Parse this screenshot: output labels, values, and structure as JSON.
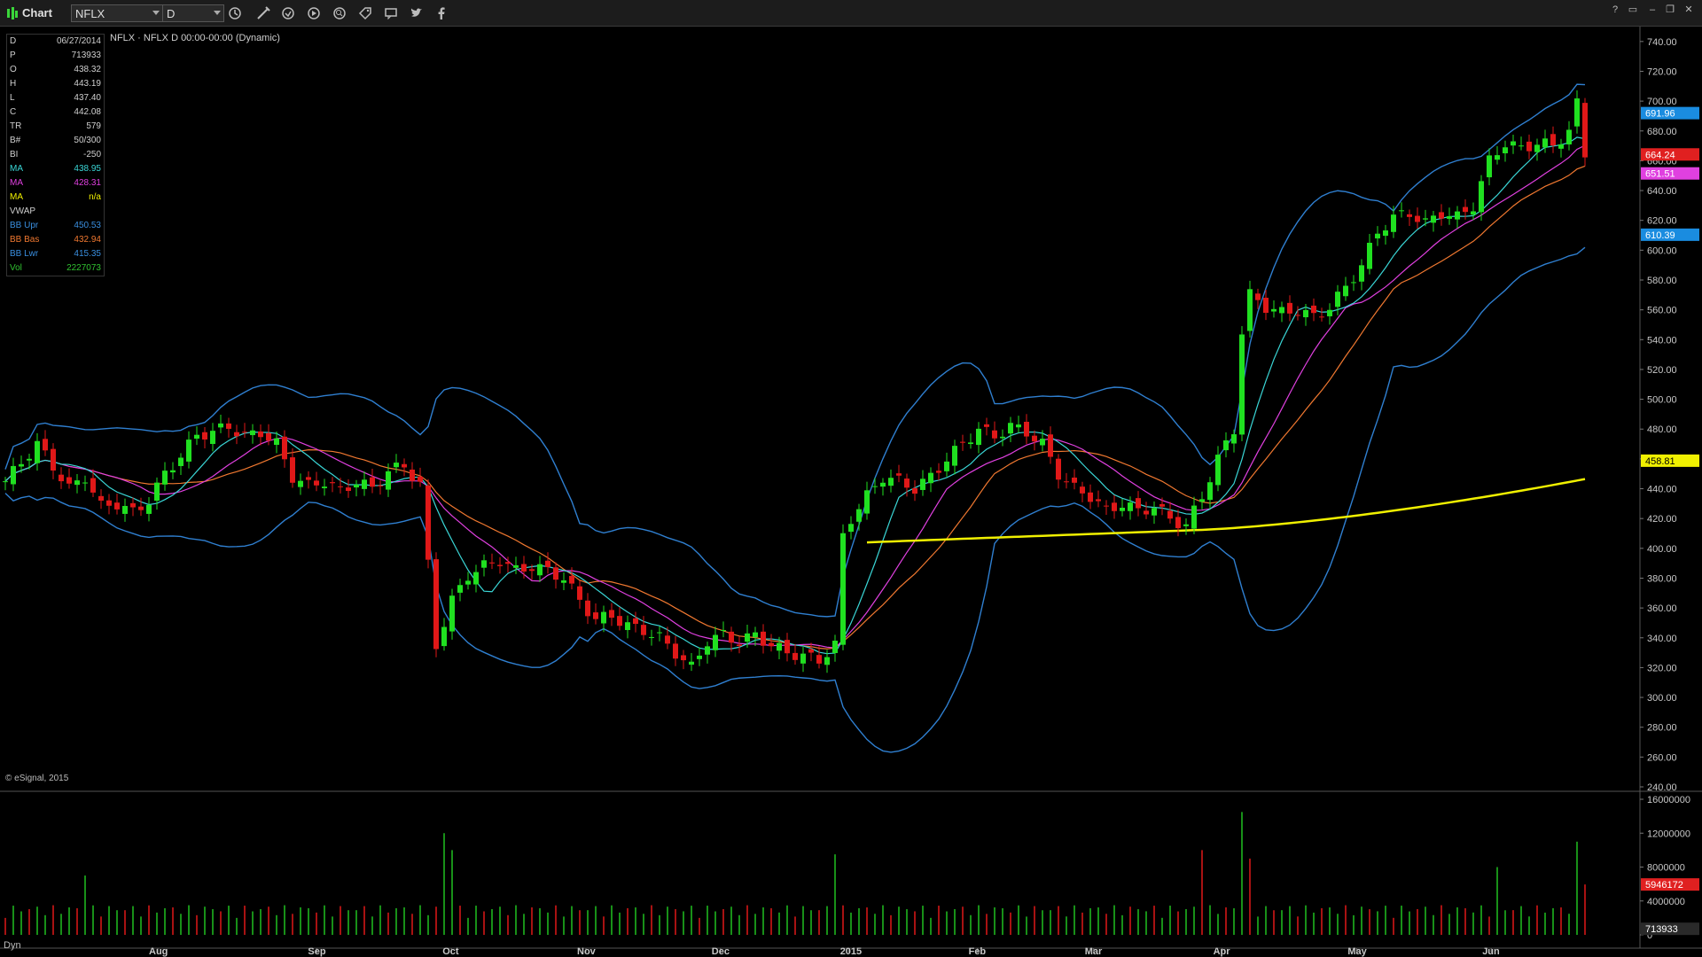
{
  "window": {
    "title": "Chart"
  },
  "toolbar": {
    "symbol": "NFLX",
    "interval": "D",
    "icons": [
      "interval-settings-icon",
      "draw-line-icon",
      "refresh-icon",
      "play-icon",
      "search-icon",
      "tag-icon",
      "message-icon",
      "twitter-icon",
      "facebook-icon"
    ]
  },
  "window_controls": [
    "?",
    "▭",
    "–",
    "❐",
    "✕"
  ],
  "header_label": "NFLX · NFLX D  00:00-00:00 (Dynamic)",
  "info_panel": [
    {
      "label": "D",
      "value": "06/27/2014",
      "color": "#cfcfcf"
    },
    {
      "label": "P",
      "value": "713933",
      "color": "#cfcfcf"
    },
    {
      "label": "O",
      "value": "438.32",
      "color": "#cfcfcf"
    },
    {
      "label": "H",
      "value": "443.19",
      "color": "#cfcfcf"
    },
    {
      "label": "L",
      "value": "437.40",
      "color": "#cfcfcf"
    },
    {
      "label": "C",
      "value": "442.08",
      "color": "#cfcfcf"
    },
    {
      "label": "TR",
      "value": "579",
      "color": "#cfcfcf"
    },
    {
      "label": "B#",
      "value": "50/300",
      "color": "#cfcfcf"
    },
    {
      "label": "BI",
      "value": "-250",
      "color": "#cfcfcf"
    },
    {
      "label": "MA",
      "value": "438.95",
      "color": "#3ad6d6"
    },
    {
      "label": "MA",
      "value": "428.31",
      "color": "#e040e0"
    },
    {
      "label": "MA",
      "value": "n/a",
      "color": "#f0f000"
    },
    {
      "label": "VWAP",
      "value": "",
      "color": "#cfcfcf"
    },
    {
      "label": "BB Upr",
      "value": "450.53",
      "color": "#3a8fe0"
    },
    {
      "label": "BB Bas",
      "value": "432.94",
      "color": "#f07830"
    },
    {
      "label": "BB Lwr",
      "value": "415.35",
      "color": "#3a8fe0"
    },
    {
      "label": "Vol",
      "value": "2227073",
      "color": "#30c030"
    }
  ],
  "copyright": "© eSignal, 2015",
  "dyn_label": "Dyn",
  "chart_data": {
    "type": "candlestick",
    "title": "",
    "price_axis": {
      "ylim": [
        240,
        750
      ],
      "ticks": [
        240,
        260,
        280,
        300,
        320,
        340,
        360,
        380,
        400,
        420,
        440,
        460,
        480,
        500,
        520,
        540,
        560,
        580,
        600,
        620,
        640,
        660,
        680,
        700,
        720,
        740
      ]
    },
    "volume_axis": {
      "ylim": [
        0,
        16000000
      ],
      "ticks": [
        0,
        4000000,
        8000000,
        12000000,
        16000000
      ]
    },
    "x_ticks": [
      "Aug",
      "Sep",
      "Oct",
      "Nov",
      "Dec",
      "2015",
      "Feb",
      "Mar",
      "Apr",
      "May",
      "Jun"
    ],
    "price_tags": [
      {
        "value": "691.96",
        "bg": "#1a8ce0",
        "fg": "#ffffff"
      },
      {
        "value": "664.24",
        "bg": "#e02020",
        "fg": "#ffffff"
      },
      {
        "value": "651.51",
        "bg": "#e040e0",
        "fg": "#ffffff"
      },
      {
        "value": "610.39",
        "bg": "#1a8ce0",
        "fg": "#ffffff"
      },
      {
        "value": "458.81",
        "bg": "#f0f000",
        "fg": "#000000"
      }
    ],
    "volume_tags": [
      {
        "value": "5946172",
        "bg": "#e02020",
        "fg": "#ffffff"
      },
      {
        "value": "713933",
        "bg": "#2a2a2a",
        "fg": "#ffffff"
      }
    ],
    "close_path": [
      [
        0,
        445
      ],
      [
        4,
        470
      ],
      [
        6,
        455
      ],
      [
        8,
        440
      ],
      [
        10,
        448
      ],
      [
        12,
        428
      ],
      [
        14,
        430
      ],
      [
        16,
        424
      ],
      [
        18,
        432
      ],
      [
        20,
        450
      ],
      [
        22,
        462
      ],
      [
        24,
        476
      ],
      [
        26,
        478
      ],
      [
        28,
        482
      ],
      [
        30,
        475
      ],
      [
        32,
        478
      ],
      [
        34,
        470
      ],
      [
        36,
        448
      ],
      [
        38,
        442
      ],
      [
        40,
        445
      ],
      [
        42,
        438
      ],
      [
        44,
        445
      ],
      [
        46,
        440
      ],
      [
        48,
        452
      ],
      [
        50,
        455
      ],
      [
        52,
        443
      ],
      [
        54,
        335
      ],
      [
        56,
        365
      ],
      [
        58,
        382
      ],
      [
        60,
        388
      ],
      [
        62,
        392
      ],
      [
        64,
        385
      ],
      [
        66,
        388
      ],
      [
        68,
        385
      ],
      [
        70,
        380
      ],
      [
        72,
        365
      ],
      [
        74,
        352
      ],
      [
        76,
        355
      ],
      [
        78,
        348
      ],
      [
        80,
        345
      ],
      [
        82,
        340
      ],
      [
        84,
        330
      ],
      [
        86,
        320
      ],
      [
        88,
        338
      ],
      [
        90,
        342
      ],
      [
        92,
        337
      ],
      [
        94,
        342
      ],
      [
        96,
        335
      ],
      [
        98,
        330
      ],
      [
        100,
        328
      ],
      [
        102,
        325
      ],
      [
        104,
        335
      ],
      [
        105,
        408
      ],
      [
        106,
        420
      ],
      [
        108,
        435
      ],
      [
        110,
        448
      ],
      [
        112,
        445
      ],
      [
        114,
        440
      ],
      [
        116,
        448
      ],
      [
        118,
        460
      ],
      [
        120,
        470
      ],
      [
        122,
        480
      ],
      [
        124,
        475
      ],
      [
        126,
        482
      ],
      [
        128,
        478
      ],
      [
        130,
        470
      ],
      [
        132,
        450
      ],
      [
        134,
        440
      ],
      [
        136,
        435
      ],
      [
        138,
        425
      ],
      [
        140,
        430
      ],
      [
        142,
        425
      ],
      [
        144,
        428
      ],
      [
        146,
        420
      ],
      [
        148,
        415
      ],
      [
        150,
        435
      ],
      [
        152,
        460
      ],
      [
        154,
        480
      ],
      [
        155,
        545
      ],
      [
        156,
        570
      ],
      [
        158,
        562
      ],
      [
        160,
        558
      ],
      [
        162,
        560
      ],
      [
        164,
        555
      ],
      [
        166,
        562
      ],
      [
        168,
        575
      ],
      [
        170,
        590
      ],
      [
        172,
        612
      ],
      [
        174,
        622
      ],
      [
        176,
        625
      ],
      [
        178,
        618
      ],
      [
        180,
        625
      ],
      [
        182,
        622
      ],
      [
        184,
        630
      ],
      [
        186,
        660
      ],
      [
        188,
        672
      ],
      [
        190,
        668
      ],
      [
        192,
        672
      ],
      [
        194,
        670
      ],
      [
        196,
        680
      ],
      [
        197,
        698
      ],
      [
        198,
        664
      ]
    ],
    "volume_bars": [
      [
        10,
        7000000
      ],
      [
        55,
        12000000
      ],
      [
        56,
        10000000
      ],
      [
        104,
        9500000
      ],
      [
        150,
        10000000
      ],
      [
        155,
        14500000
      ],
      [
        156,
        9000000
      ],
      [
        187,
        8000000
      ],
      [
        197,
        11000000
      ],
      [
        198,
        5946172
      ]
    ]
  }
}
